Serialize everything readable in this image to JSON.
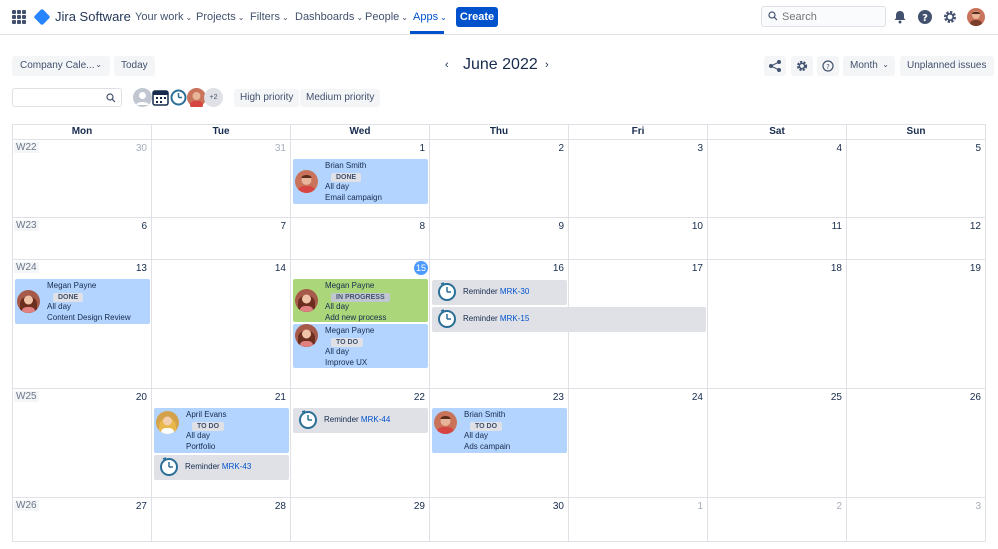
{
  "nav": {
    "product_name": "Jira Software",
    "items": [
      {
        "label": "Your work",
        "chev": "⌄"
      },
      {
        "label": "Projects",
        "chev": "⌄"
      },
      {
        "label": "Filters",
        "chev": "⌄"
      },
      {
        "label": "Dashboards",
        "chev": "⌄"
      },
      {
        "label": "People",
        "chev": "⌄"
      },
      {
        "label": "Apps",
        "chev": "⌄"
      }
    ],
    "create_label": "Create",
    "search_placeholder": "Search",
    "accent": "#0052cc"
  },
  "toolbar": {
    "calendar_select": "Company Cale...",
    "chev": "⌄",
    "today_label": "Today",
    "month_title": "June 2022",
    "prev": "‹",
    "next": "›",
    "view_select": "Month",
    "unplanned_label": "Unplanned issues"
  },
  "filters": {
    "more_users": "+2",
    "priority_high": "High priority",
    "priority_medium": "Medium priority"
  },
  "calendar": {
    "weekdays": [
      "Mon",
      "Tue",
      "Wed",
      "Thu",
      "Fri",
      "Sat",
      "Sun"
    ],
    "weeks": [
      {
        "label": "W22",
        "days": [
          "30",
          "31",
          "1",
          "2",
          "3",
          "4",
          "5"
        ]
      },
      {
        "label": "W23",
        "days": [
          "6",
          "7",
          "8",
          "9",
          "10",
          "11",
          "12"
        ]
      },
      {
        "label": "W24",
        "days": [
          "13",
          "14",
          "15",
          "16",
          "17",
          "18",
          "19"
        ]
      },
      {
        "label": "W25",
        "days": [
          "20",
          "21",
          "22",
          "23",
          "24",
          "25",
          "26"
        ]
      },
      {
        "label": "W26",
        "days": [
          "27",
          "28",
          "29",
          "30",
          "1",
          "2",
          "3"
        ]
      }
    ],
    "today": "15"
  },
  "events": {
    "e1": {
      "name": "Brian Smith",
      "status": "DONE",
      "when": "All day",
      "title": "Email campaign"
    },
    "e2": {
      "name": "Megan Payne",
      "status": "DONE",
      "when": "All day",
      "title": "Content Design Review"
    },
    "e3": {
      "name": "Megan Payne",
      "status": "IN PROGRESS",
      "when": "All day",
      "title": "Add new process"
    },
    "e4": {
      "name": "Megan Payne",
      "status": "TO DO",
      "when": "All day",
      "title": "Improve UX"
    },
    "r1": {
      "label": "Reminder",
      "key": "MRK-30"
    },
    "r2": {
      "label": "Reminder",
      "key": "MRK-15"
    },
    "e5": {
      "name": "April Evans",
      "status": "TO DO",
      "when": "All day",
      "title": "Portfolio"
    },
    "r3": {
      "label": "Reminder",
      "key": "MRK-44"
    },
    "e6": {
      "name": "Brian Smith",
      "status": "TO DO",
      "when": "All day",
      "title": "Ads campain"
    },
    "r4": {
      "label": "Reminder",
      "key": "MRK-43"
    }
  }
}
